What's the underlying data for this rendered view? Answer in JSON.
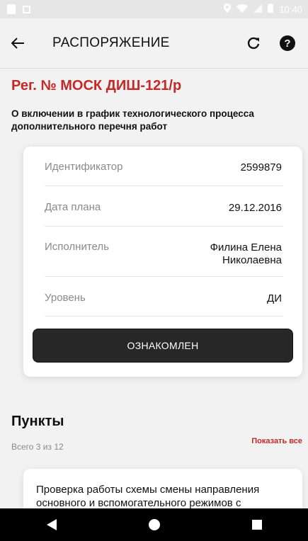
{
  "status_bar": {
    "time": "10:40"
  },
  "appbar": {
    "title": "РАСПОРЯЖЕНИЕ",
    "help_glyph": "?"
  },
  "document": {
    "reg_number": "Рег. № МОСК ДИШ-121/р",
    "subtitle": "О включении в график технологического процесса дополнительного перечня работ"
  },
  "details": {
    "rows": [
      {
        "label": "Идентификатор",
        "value": "2599879"
      },
      {
        "label": "Дата плана",
        "value": "29.12.2016"
      },
      {
        "label": "Исполнитель",
        "value_line1": "Филина Елена",
        "value_line2": "Николаевна"
      },
      {
        "label": "Уровень",
        "value": "ДИ"
      }
    ],
    "ack_button": "ОЗНАКОМЛЕН"
  },
  "points": {
    "title": "Пункты",
    "show_all": "Показать все",
    "count": "Всего 3 из 12",
    "first_item": "Проверка работы схемы смены направления основного и вспомогательного режимов с"
  },
  "colors": {
    "accent": "#c62828",
    "button_dark": "#272727",
    "background": "#f2f2f2"
  },
  "icons": [
    "back-arrow-icon",
    "refresh-icon",
    "help-icon",
    "nav-back-icon",
    "nav-home-icon",
    "nav-recents-icon"
  ]
}
